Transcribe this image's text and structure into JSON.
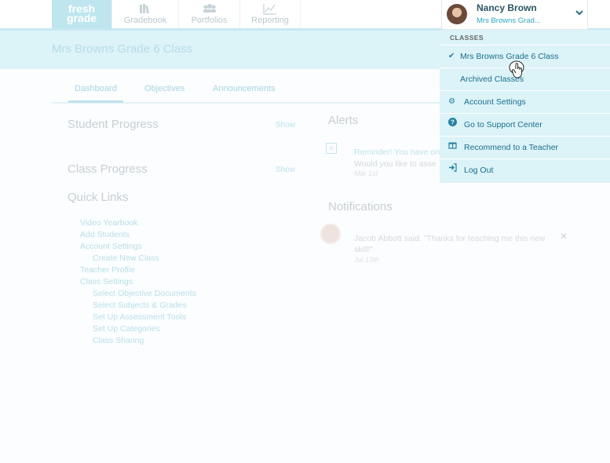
{
  "topnav": {
    "logo": {
      "line1": "fresh",
      "line2": "grade"
    },
    "tabs": [
      {
        "label": "Gradebook",
        "icon": "books-icon"
      },
      {
        "label": "Portfolios",
        "icon": "people-icon"
      },
      {
        "label": "Reporting",
        "icon": "chart-icon"
      }
    ]
  },
  "banner": {
    "title": "Mrs Browns Grade 6 Class"
  },
  "subtabs": [
    {
      "label": "Dashboard",
      "active": true
    },
    {
      "label": "Objectives"
    },
    {
      "label": "Announcements"
    }
  ],
  "left": {
    "student_progress": {
      "title": "Student Progress",
      "show": "Show"
    },
    "class_progress": {
      "title": "Class Progress",
      "show": "Show"
    },
    "quick_links": {
      "title": "Quick Links",
      "items": [
        {
          "label": "Video Yearbook"
        },
        {
          "label": "Add Students"
        },
        {
          "label": "Account Settings"
        },
        {
          "label": "Create New Class"
        },
        {
          "label": "Teacher Profile"
        },
        {
          "label": "Class Settings"
        },
        {
          "label": "Select Objective Documents"
        },
        {
          "label": "Select Subjects & Grades"
        },
        {
          "label": "Set Up Assessment Tools"
        },
        {
          "label": "Set Up Categories"
        },
        {
          "label": "Class Sharing"
        }
      ]
    }
  },
  "alerts": {
    "title": "Alerts",
    "item": {
      "text": "Reminder! You have on",
      "sub": "Would you like to asse",
      "date": "Mar 1st"
    }
  },
  "notifications": {
    "title": "Notifications",
    "item": {
      "text": "Jacob Abbott said: \"Thanks for teaching me this new skill!\"",
      "date": "Jul 13th",
      "close": "✕"
    }
  },
  "user_menu": {
    "name": "Nancy Brown",
    "class_short": "Mrs Browns Grad...",
    "chevron": "⌄",
    "section_label": "CLASSES",
    "items": [
      {
        "label": "Mrs Browns Grade 6 Class",
        "icon": "✔"
      },
      {
        "label": "Archived Classes",
        "icon": ""
      },
      {
        "label": "Account Settings",
        "icon": "⚙"
      },
      {
        "label": "Go to Support Center",
        "icon": "?"
      },
      {
        "label": "Recommend to a Teacher",
        "icon": "🎁"
      },
      {
        "label": "Log Out",
        "icon": "⇥"
      }
    ]
  },
  "colors": {
    "accent": "#1c6e8e",
    "menu_bg": "#dcf3f8",
    "banner_bg": "#dcf3f8"
  }
}
